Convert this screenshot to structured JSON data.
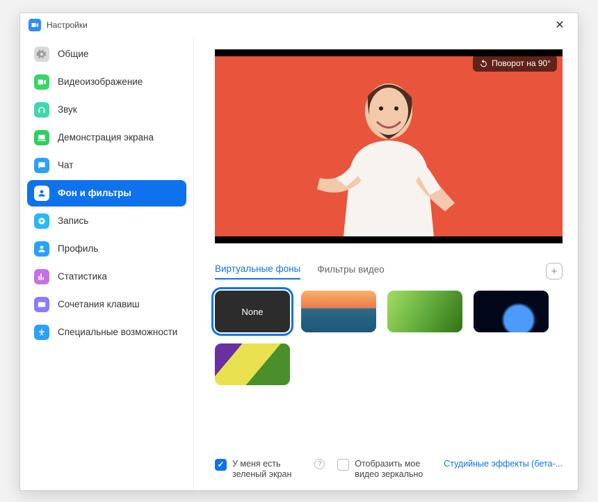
{
  "window": {
    "title": "Настройки"
  },
  "sidebar": [
    {
      "key": "general",
      "label": "Общие",
      "color": "#d9d9d9",
      "icon": "gear"
    },
    {
      "key": "video",
      "label": "Видеоизображение",
      "color": "#38d666",
      "icon": "video"
    },
    {
      "key": "audio",
      "label": "Звук",
      "color": "#3fd7af",
      "icon": "headphones"
    },
    {
      "key": "share",
      "label": "Демонстрация экрана",
      "color": "#2ecf5f",
      "icon": "share"
    },
    {
      "key": "chat",
      "label": "Чат",
      "color": "#2aa0ff",
      "icon": "chat"
    },
    {
      "key": "bg",
      "label": "Фон и фильтры",
      "color": "#ffffff",
      "icon": "person",
      "selected": true
    },
    {
      "key": "record",
      "label": "Запись",
      "color": "#26b7ff",
      "icon": "record"
    },
    {
      "key": "profile",
      "label": "Профиль",
      "color": "#2aa0ff",
      "icon": "profile"
    },
    {
      "key": "stats",
      "label": "Статистика",
      "color": "#c670e6",
      "icon": "stats"
    },
    {
      "key": "shortcuts",
      "label": "Сочетания клавиш",
      "color": "#8a7bff",
      "icon": "keyboard"
    },
    {
      "key": "access",
      "label": "Специальные возможности",
      "color": "#2aa0ff",
      "icon": "access"
    }
  ],
  "preview": {
    "rotate_label": "Поворот на 90°"
  },
  "tabs": {
    "virtual": "Виртуальные фоны",
    "filters": "Фильтры видео",
    "active": "virtual"
  },
  "bg_options": [
    {
      "key": "none",
      "label": "None",
      "selected": true
    },
    {
      "key": "bridge",
      "label": ""
    },
    {
      "key": "grass",
      "label": ""
    },
    {
      "key": "earth",
      "label": ""
    },
    {
      "key": "flowers",
      "label": ""
    }
  ],
  "footer": {
    "green_screen": {
      "label": "У меня есть зеленый экран",
      "checked": true
    },
    "mirror": {
      "label": "Отобразить мое видео зеркально",
      "checked": false
    },
    "studio_link": "Студийные эффекты (бета-..."
  }
}
